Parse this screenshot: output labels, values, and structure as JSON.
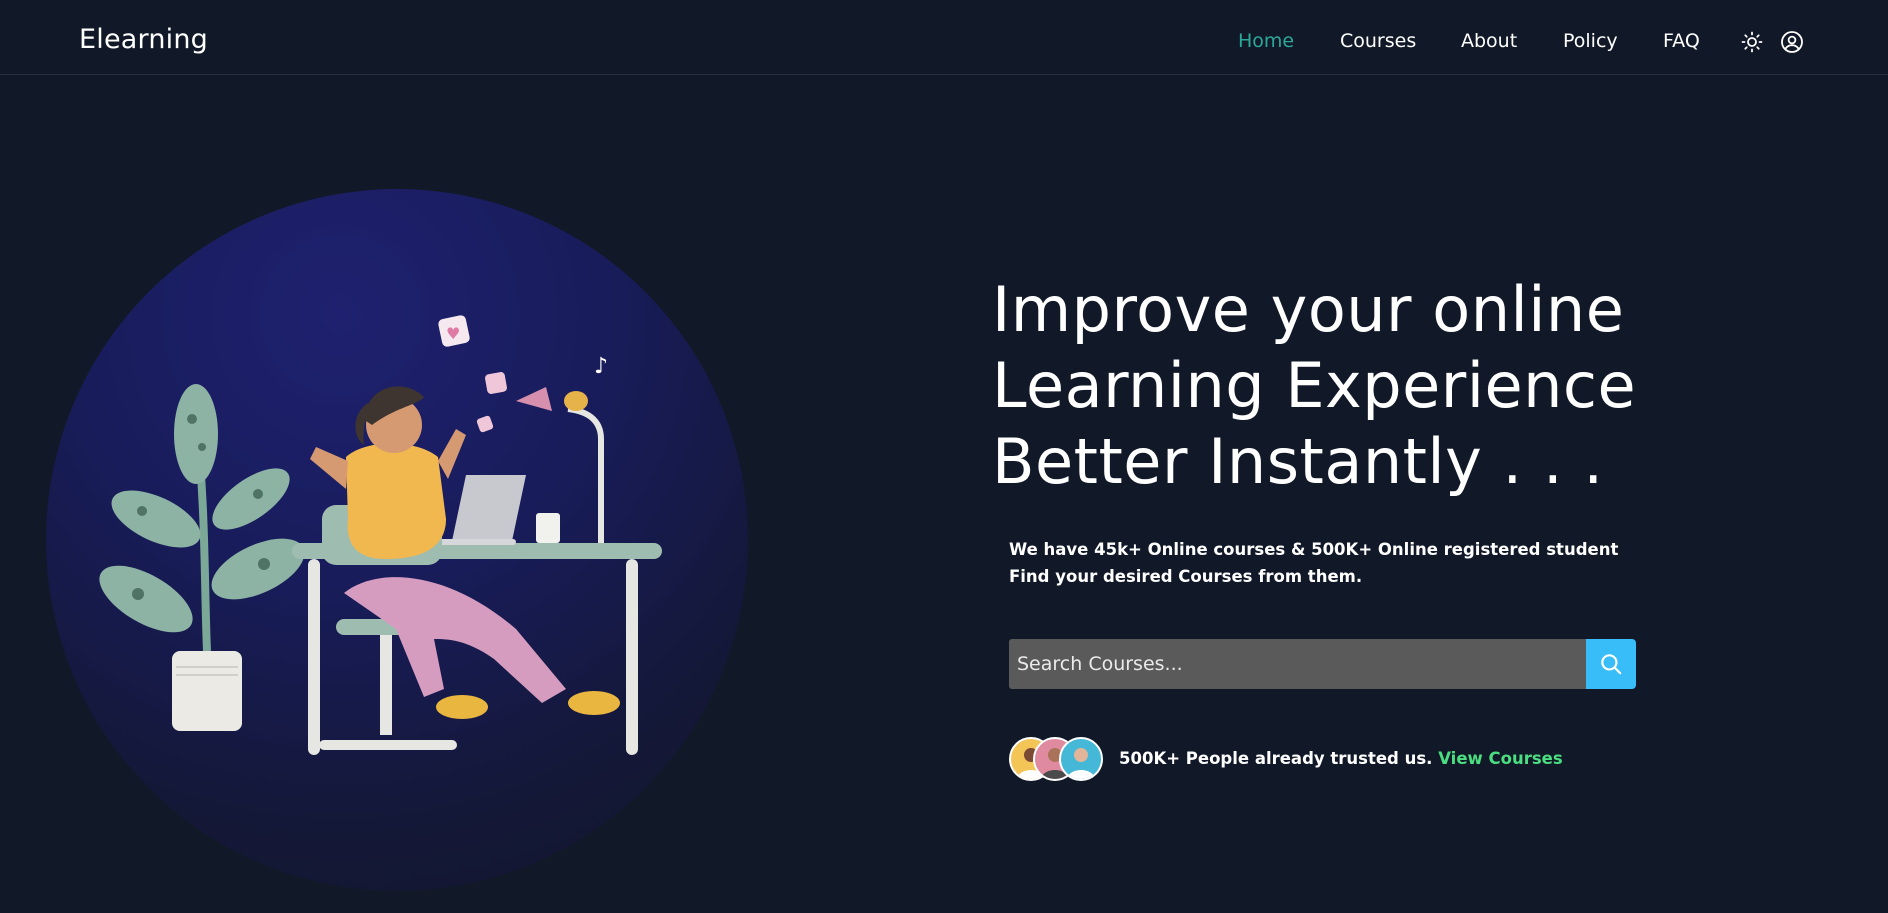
{
  "header": {
    "brand": "Elearning",
    "nav": [
      {
        "label": "Home",
        "active": true
      },
      {
        "label": "Courses",
        "active": false
      },
      {
        "label": "About",
        "active": false
      },
      {
        "label": "Policy",
        "active": false
      },
      {
        "label": "FAQ",
        "active": false
      }
    ],
    "icons": [
      "sun-icon",
      "user-icon"
    ]
  },
  "hero": {
    "headline": [
      "Improve your online",
      "Learning Experience",
      "Better Instantly . . ."
    ],
    "description": "We have 45k+ Online courses & 500K+ Online registered student Find your desired Courses from them.",
    "search": {
      "placeholder": "Search Courses...",
      "value": "",
      "icon": "search-icon"
    },
    "trust_text": "500K+ People already trusted us.",
    "trust_link": "View Courses"
  },
  "colors": {
    "background": "#111827",
    "accent_nav": "#2ba89a",
    "search_button": "#38bdf8",
    "link": "#4ade80",
    "circle": "#1f2170"
  }
}
